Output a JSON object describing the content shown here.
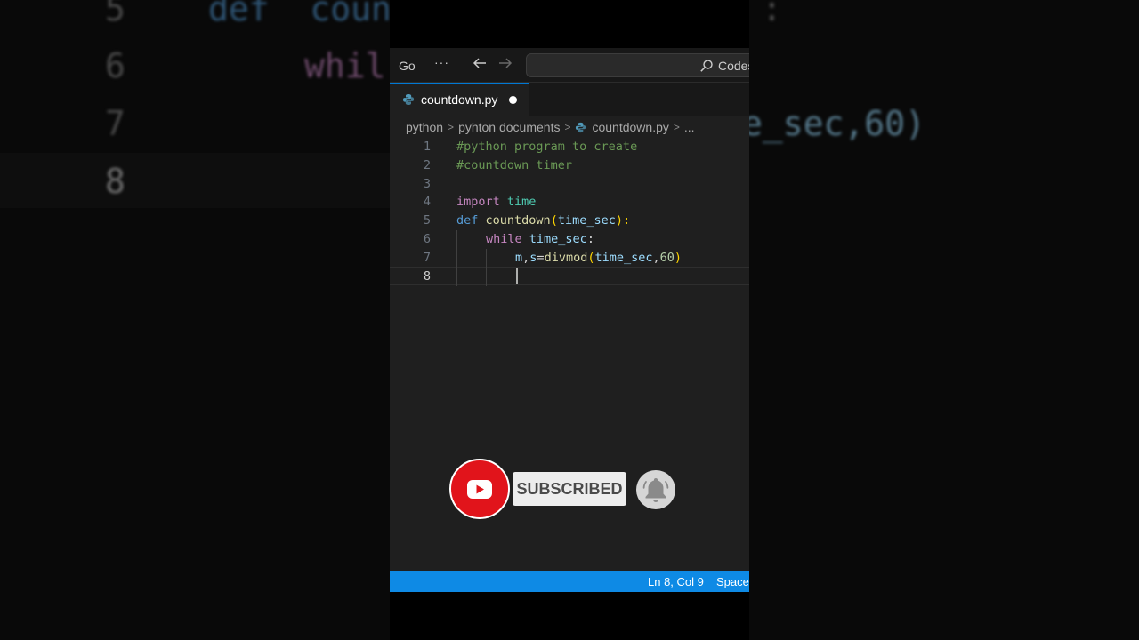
{
  "background_blur": {
    "lines": [
      {
        "number": "5",
        "text": "def  coun"
      },
      {
        "number": "6",
        "text": "whil"
      },
      {
        "number": "7",
        "text": ""
      },
      {
        "number": "8",
        "text": ""
      }
    ],
    "right_fragment": "e_sec,60)"
  },
  "titlebar": {
    "menu_go": "Go",
    "more": "···",
    "search_text": "Codes"
  },
  "tab": {
    "filename": "countdown.py"
  },
  "breadcrumb": {
    "folder": "python",
    "subfolder": "pyhton documents",
    "file": "countdown.py",
    "more": "..."
  },
  "code": {
    "line_numbers": [
      "1",
      "2",
      "3",
      "4",
      "5",
      "6",
      "7",
      "8"
    ],
    "line1": "#python program to create",
    "line2": "#countdown timer",
    "l4_kw": "import",
    "l4_mod": "time",
    "l5_def": "def",
    "l5_fn": "countdown",
    "l5_open": "(",
    "l5_arg": "time_sec",
    "l5_close": "):",
    "l6_kw": "while",
    "l6_var": "time_sec",
    "l6_colon": ":",
    "l7_m": "m",
    "l7_comma1": ",",
    "l7_s": "s",
    "l7_eq": "=",
    "l7_fn": "divmod",
    "l7_open": "(",
    "l7_arg": "time_sec",
    "l7_comma2": ",",
    "l7_num": "60",
    "l7_close": ")"
  },
  "statusbar": {
    "position": "Ln 8, Col 9",
    "spaces": "Spaces"
  },
  "subscribe": {
    "label": "SUBSCRIBED"
  },
  "colors": {
    "statusbar": "#0e8ae5",
    "youtube_red": "#e1141b",
    "editor_bg": "#1f1f1f"
  }
}
